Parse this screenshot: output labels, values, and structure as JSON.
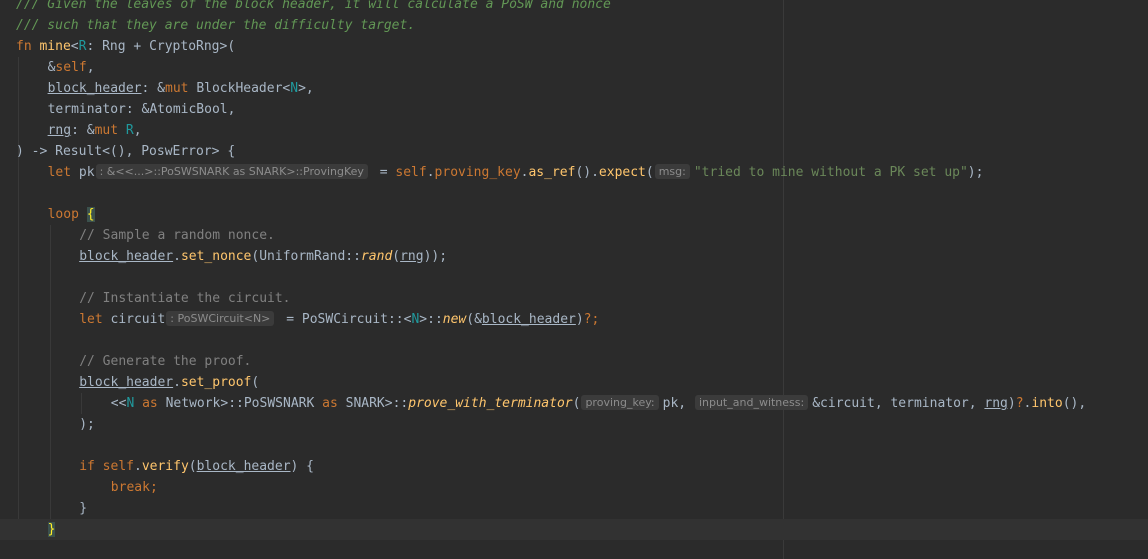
{
  "editor": {
    "lines": [
      {
        "indent": 0,
        "tokens": [
          {
            "t": "/// Given the leaves of the block header, it will calculate a PoSW and nonce",
            "c": "doc"
          }
        ]
      },
      {
        "indent": 0,
        "tokens": [
          {
            "t": "/// such that they are under the difficulty target.",
            "c": "doc"
          }
        ]
      },
      {
        "indent": 0,
        "tokens": [
          {
            "t": "fn ",
            "c": "kw"
          },
          {
            "t": "mine",
            "c": "fn"
          },
          {
            "t": "<",
            "c": "op"
          },
          {
            "t": "R",
            "c": "tp"
          },
          {
            "t": ": Rng + CryptoRng>(",
            "c": "op"
          }
        ]
      },
      {
        "indent": 1,
        "tokens": [
          {
            "t": "&",
            "c": "op"
          },
          {
            "t": "self",
            "c": "kw"
          },
          {
            "t": ",",
            "c": "op"
          }
        ]
      },
      {
        "indent": 1,
        "tokens": [
          {
            "t": "block_header",
            "c": "lt ul"
          },
          {
            "t": ": &",
            "c": "op"
          },
          {
            "t": "mut ",
            "c": "kw"
          },
          {
            "t": "BlockHeader<",
            "c": "ty"
          },
          {
            "t": "N",
            "c": "tp"
          },
          {
            "t": ">,",
            "c": "op"
          }
        ]
      },
      {
        "indent": 1,
        "tokens": [
          {
            "t": "terminator: &AtomicBool,",
            "c": "op"
          }
        ]
      },
      {
        "indent": 1,
        "tokens": [
          {
            "t": "rng",
            "c": "lt ul"
          },
          {
            "t": ": &",
            "c": "op"
          },
          {
            "t": "mut ",
            "c": "kw"
          },
          {
            "t": "R",
            "c": "tp"
          },
          {
            "t": ",",
            "c": "op"
          }
        ]
      },
      {
        "indent": 0,
        "tokens": [
          {
            "t": ") -> Result<(), PoswError> {",
            "c": "op"
          }
        ]
      },
      {
        "indent": 1,
        "tokens": [
          {
            "t": "let ",
            "c": "kw"
          },
          {
            "t": "pk",
            "c": "op"
          },
          {
            "hint": ": &<<...>::PoSWSNARK as SNARK>::ProvingKey"
          },
          {
            "t": " = ",
            "c": "op"
          },
          {
            "t": "self",
            "c": "kw"
          },
          {
            "t": ".",
            "c": "op"
          },
          {
            "t": "proving_key",
            "c": "kw"
          },
          {
            "t": ".",
            "c": "op"
          },
          {
            "t": "as_ref",
            "c": "fn"
          },
          {
            "t": "().",
            "c": "op"
          },
          {
            "t": "expect",
            "c": "fn"
          },
          {
            "t": "(",
            "c": "op"
          },
          {
            "hint": "msg:"
          },
          {
            "t": "\"tried to mine without a PK set up\"",
            "c": "str"
          },
          {
            "t": ");",
            "c": "op"
          }
        ]
      },
      {
        "indent": 0,
        "tokens": []
      },
      {
        "indent": 1,
        "tokens": [
          {
            "t": "loop ",
            "c": "kw"
          },
          {
            "t": "{",
            "c": "brace-match"
          }
        ]
      },
      {
        "indent": 2,
        "tokens": [
          {
            "t": "// Sample a random nonce.",
            "c": "cmt"
          }
        ]
      },
      {
        "indent": 2,
        "tokens": [
          {
            "t": "block_header",
            "c": "lt ul"
          },
          {
            "t": ".",
            "c": "op"
          },
          {
            "t": "set_nonce",
            "c": "fn"
          },
          {
            "t": "(UniformRand::",
            "c": "op"
          },
          {
            "t": "rand",
            "c": "fn-it"
          },
          {
            "t": "(",
            "c": "op"
          },
          {
            "t": "rng",
            "c": "lt ul"
          },
          {
            "t": "));",
            "c": "op"
          }
        ]
      },
      {
        "indent": 0,
        "tokens": []
      },
      {
        "indent": 2,
        "tokens": [
          {
            "t": "// Instantiate the circuit.",
            "c": "cmt"
          }
        ]
      },
      {
        "indent": 2,
        "tokens": [
          {
            "t": "let ",
            "c": "kw"
          },
          {
            "t": "circuit",
            "c": "op"
          },
          {
            "hint": ": PoSWCircuit<N>"
          },
          {
            "t": " = PoSWCircuit::<",
            "c": "op"
          },
          {
            "t": "N",
            "c": "tp"
          },
          {
            "t": ">::",
            "c": "op"
          },
          {
            "t": "new",
            "c": "fn-it"
          },
          {
            "t": "(&",
            "c": "op"
          },
          {
            "t": "block_header",
            "c": "lt ul"
          },
          {
            "t": ")",
            "c": "op"
          },
          {
            "t": "?;",
            "c": "kw"
          }
        ]
      },
      {
        "indent": 0,
        "tokens": []
      },
      {
        "indent": 2,
        "tokens": [
          {
            "t": "// Generate the proof.",
            "c": "cmt"
          }
        ]
      },
      {
        "indent": 2,
        "tokens": [
          {
            "t": "block_header",
            "c": "lt ul"
          },
          {
            "t": ".",
            "c": "op"
          },
          {
            "t": "set_proof",
            "c": "fn"
          },
          {
            "t": "(",
            "c": "op"
          }
        ]
      },
      {
        "indent": 3,
        "tokens": [
          {
            "t": "<<",
            "c": "op"
          },
          {
            "t": "N",
            "c": "tp"
          },
          {
            "t": " as ",
            "c": "kw"
          },
          {
            "t": "Network>::PoSWSNARK ",
            "c": "op"
          },
          {
            "t": "as ",
            "c": "kw"
          },
          {
            "t": "SNARK>::",
            "c": "op"
          },
          {
            "t": "prove_with_terminator",
            "c": "fn-it"
          },
          {
            "t": "(",
            "c": "op"
          },
          {
            "hint": "proving_key:"
          },
          {
            "t": "pk, ",
            "c": "op"
          },
          {
            "hint": "input_and_witness:"
          },
          {
            "t": "&circuit, terminator, ",
            "c": "op"
          },
          {
            "t": "rng",
            "c": "lt ul"
          },
          {
            "t": ")",
            "c": "op"
          },
          {
            "t": "?",
            "c": "kw"
          },
          {
            "t": ".",
            "c": "op"
          },
          {
            "t": "into",
            "c": "fn"
          },
          {
            "t": "(),",
            "c": "op"
          }
        ]
      },
      {
        "indent": 2,
        "tokens": [
          {
            "t": ");",
            "c": "op"
          }
        ]
      },
      {
        "indent": 0,
        "tokens": []
      },
      {
        "indent": 2,
        "tokens": [
          {
            "t": "if ",
            "c": "kw"
          },
          {
            "t": "self",
            "c": "kw"
          },
          {
            "t": ".",
            "c": "op"
          },
          {
            "t": "verify",
            "c": "fn"
          },
          {
            "t": "(",
            "c": "op"
          },
          {
            "t": "block_header",
            "c": "lt ul"
          },
          {
            "t": ") {",
            "c": "op"
          }
        ]
      },
      {
        "indent": 3,
        "tokens": [
          {
            "t": "break",
            "c": "kw"
          },
          {
            "t": ";",
            "c": "kw"
          }
        ]
      },
      {
        "indent": 2,
        "tokens": [
          {
            "t": "}",
            "c": "op"
          }
        ]
      },
      {
        "indent": 1,
        "current": true,
        "tokens": [
          {
            "t": "}",
            "c": "brace-match"
          }
        ]
      }
    ],
    "colors": {
      "background": "#2b2b2b",
      "keyword": "#cc7832",
      "function": "#ffc66d",
      "type_param": "#20999d",
      "string": "#6a8759",
      "comment": "#808080",
      "doc_comment": "#629755"
    }
  }
}
